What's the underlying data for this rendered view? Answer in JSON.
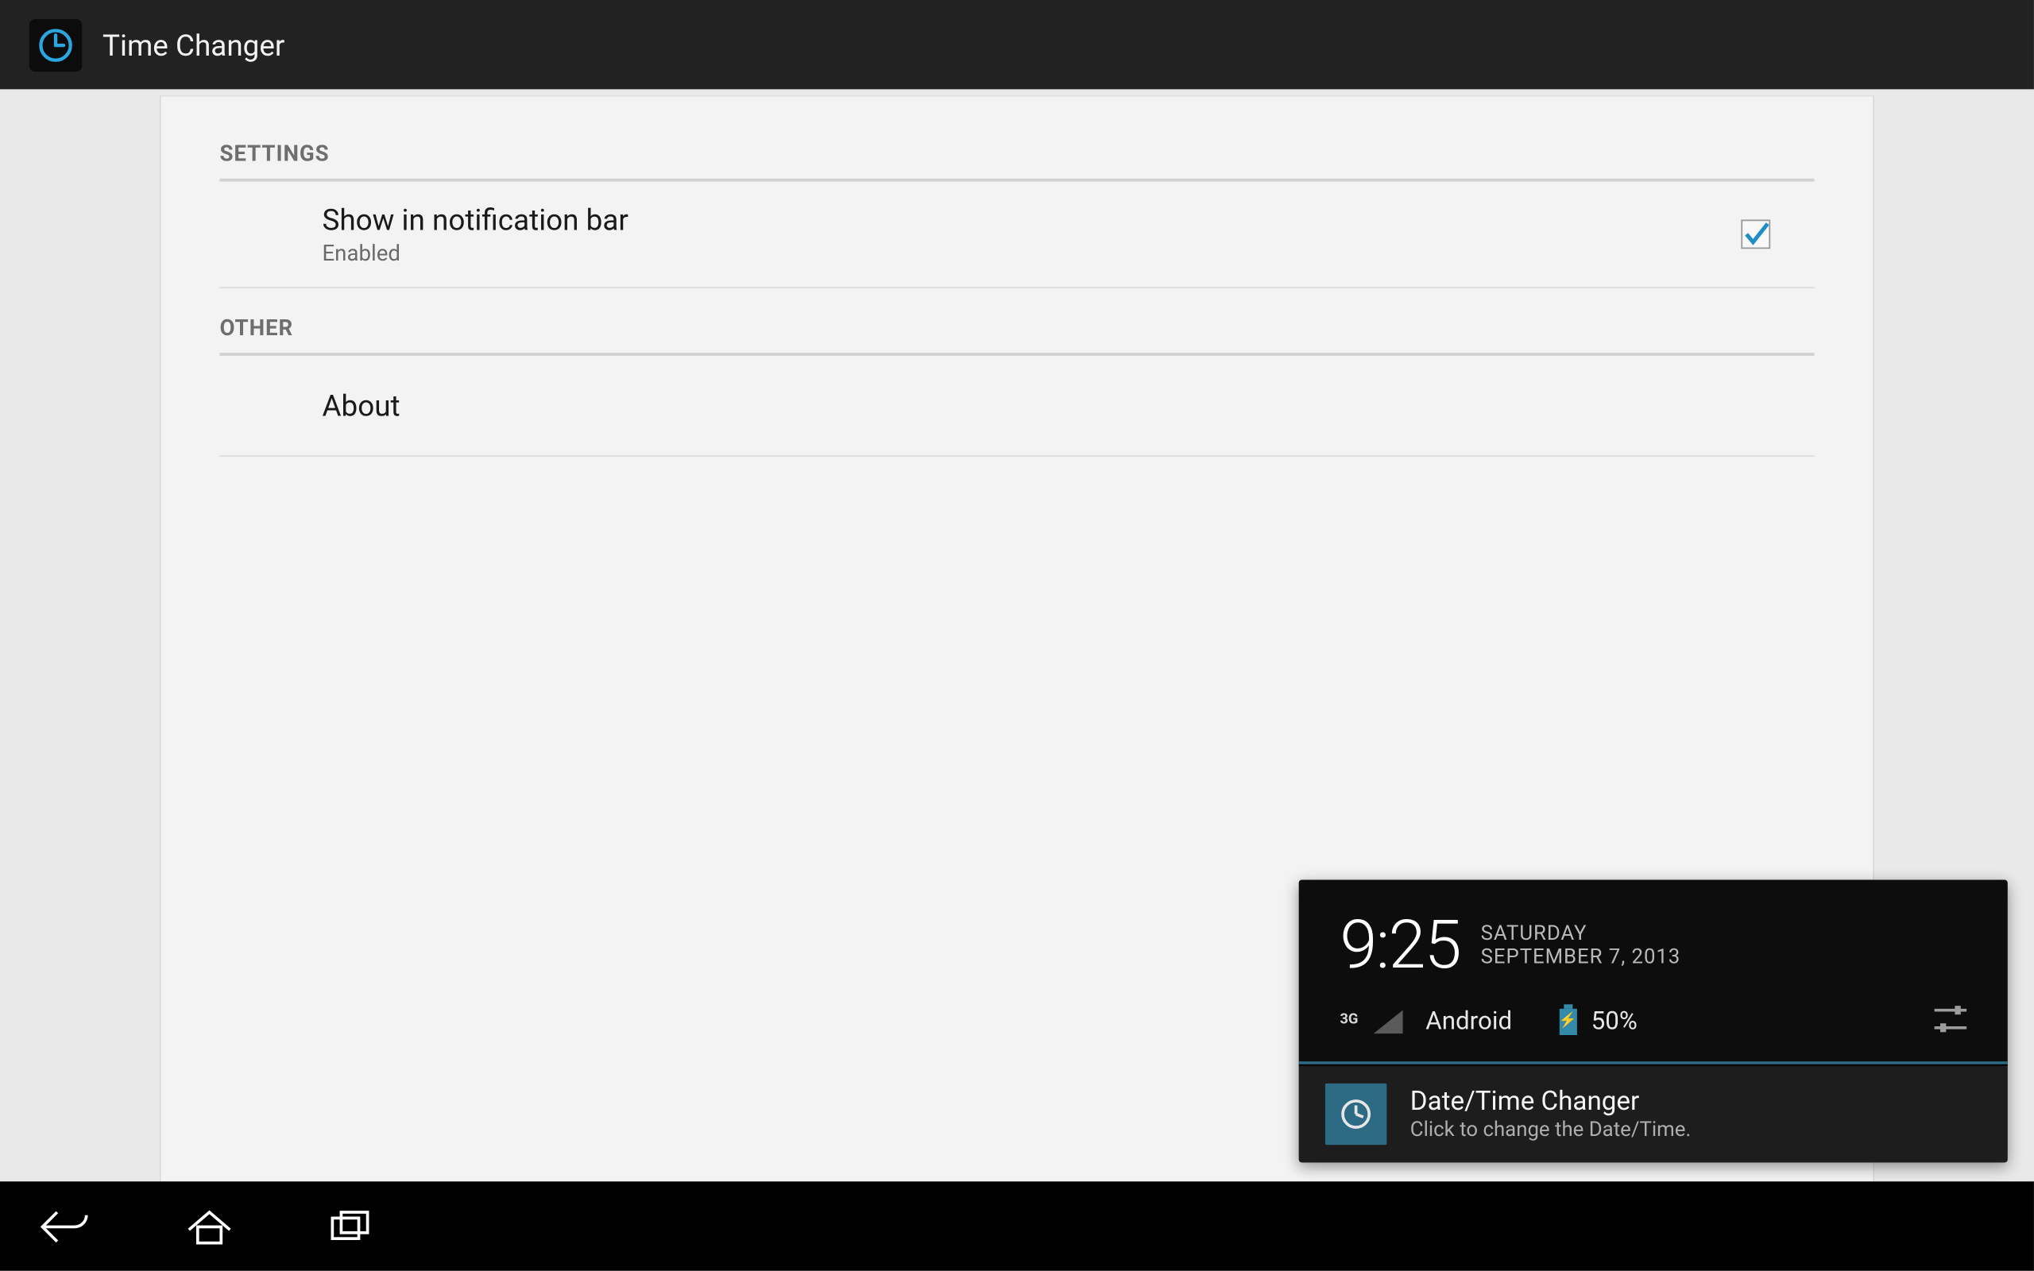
{
  "app": {
    "title": "Time Changer"
  },
  "sections": {
    "settings_header": "SETTINGS",
    "other_header": "OTHER"
  },
  "rows": {
    "show_notif": {
      "title": "Show in notification bar",
      "subtitle": "Enabled",
      "checked": true
    },
    "about": {
      "title": "About"
    }
  },
  "shade": {
    "time": "9:25",
    "day": "SATURDAY",
    "date": "SEPTEMBER 7, 2013",
    "network_type": "3G",
    "carrier": "Android",
    "battery_pct": "50%",
    "notification": {
      "title": "Date/Time Changer",
      "subtitle": "Click to change the Date/Time."
    }
  }
}
